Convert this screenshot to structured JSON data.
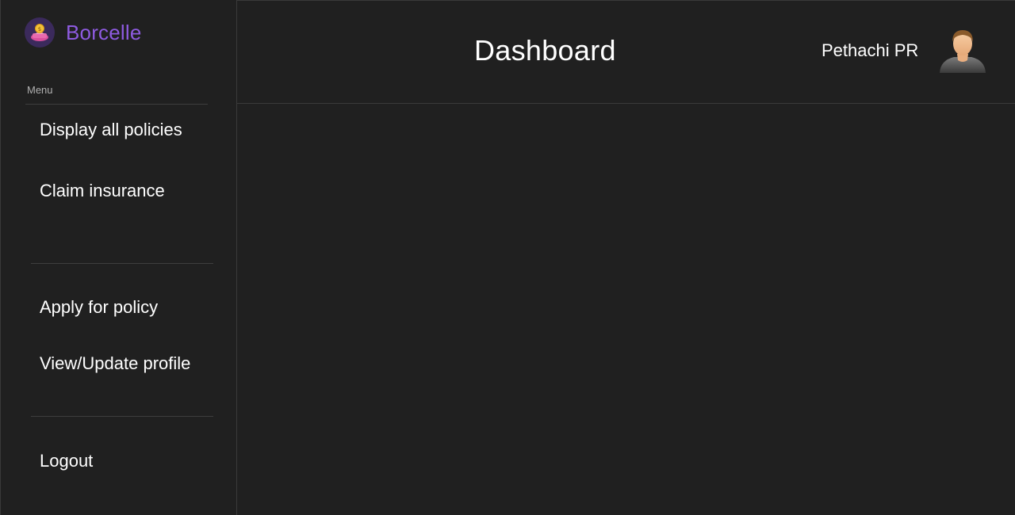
{
  "brand": {
    "name": "Borcelle"
  },
  "sidebar": {
    "menu_heading": "Menu",
    "items": [
      {
        "label": "Display all policies"
      },
      {
        "label": "Claim insurance"
      },
      {
        "label": "Apply for policy"
      },
      {
        "label": "View/Update profile"
      },
      {
        "label": "Logout"
      }
    ]
  },
  "header": {
    "title": "Dashboard",
    "user_name": "Pethachi PR"
  },
  "colors": {
    "background": "#202020",
    "brand_accent": "#8e5be0",
    "divider": "#3e3e3e"
  },
  "icons": {
    "brand_logo": "money-bag-logo-icon",
    "avatar": "user-avatar-icon"
  }
}
